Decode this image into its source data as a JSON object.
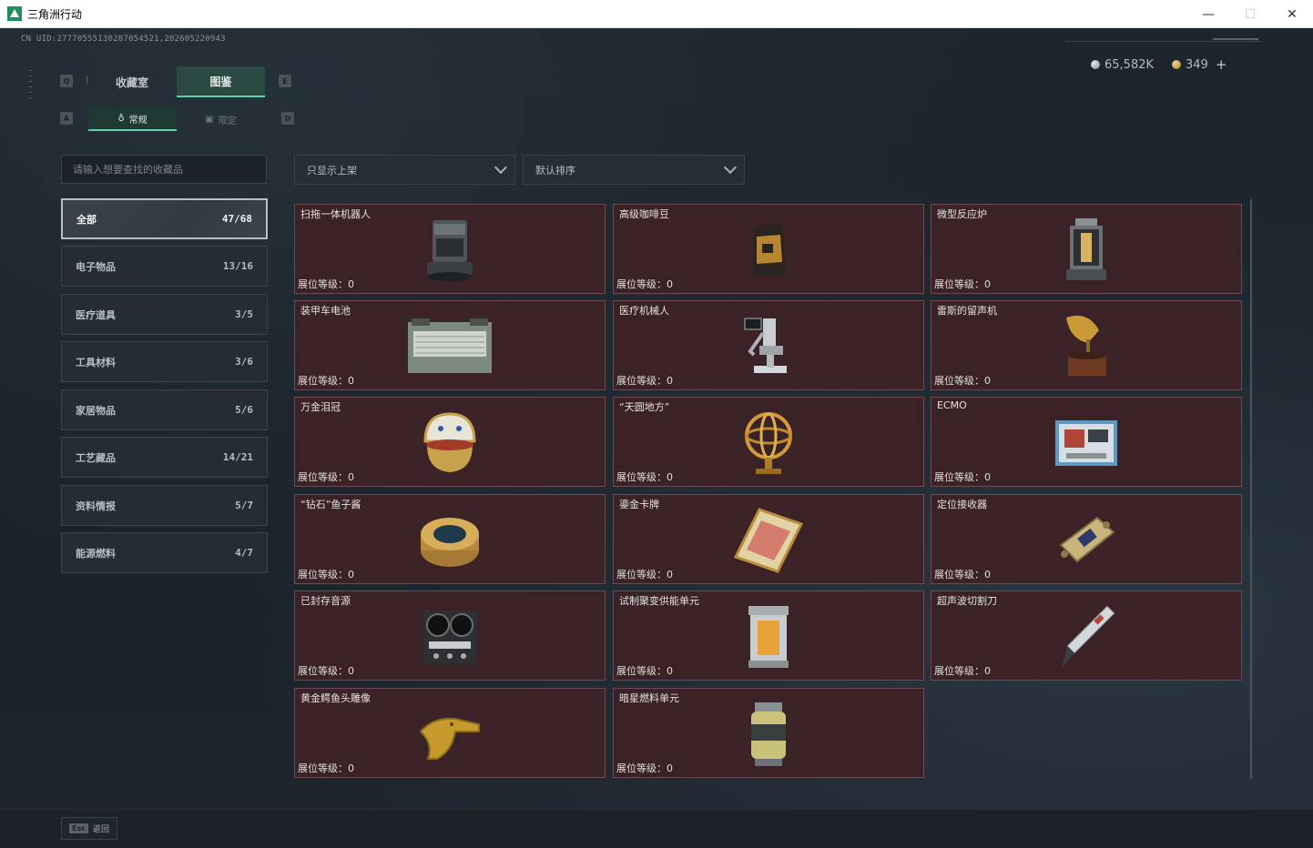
{
  "window": {
    "title": "三角洲行动",
    "minimize": "—",
    "maximize": "☐",
    "close": "✕"
  },
  "header": {
    "uid": "CN UID:27770555130287054521,202605220943",
    "currency": {
      "silver": "65,582K",
      "gold": "349",
      "plus": "+"
    }
  },
  "keys": {
    "prev_tab": "Q",
    "next_tab": "E",
    "prev_sub": "A",
    "next_sub": "D"
  },
  "tabs": [
    {
      "label": "收藏室"
    },
    {
      "label": "图鉴"
    }
  ],
  "subtabs": [
    {
      "label": "常规",
      "icon": "♁"
    },
    {
      "label": "限定",
      "icon": "▣"
    }
  ],
  "search": {
    "placeholder": "请输入想要查找的收藏品"
  },
  "filters": {
    "shelf": "只显示上架",
    "sort": "默认排序"
  },
  "categories": [
    {
      "label": "全部",
      "count": "47/68"
    },
    {
      "label": "电子物品",
      "count": "13/16"
    },
    {
      "label": "医疗道具",
      "count": "3/5"
    },
    {
      "label": "工具材料",
      "count": "3/6"
    },
    {
      "label": "家居物品",
      "count": "5/6"
    },
    {
      "label": "工艺藏品",
      "count": "14/21"
    },
    {
      "label": "资料情报",
      "count": "5/7"
    },
    {
      "label": "能源燃料",
      "count": "4/7"
    }
  ],
  "items": [
    {
      "name": "扫拖一体机器人",
      "level": "展位等级：0",
      "icon": "robot-vacuum-icon"
    },
    {
      "name": "高级咖啡豆",
      "level": "展位等级：0",
      "icon": "coffee-bag-icon"
    },
    {
      "name": "微型反应炉",
      "level": "展位等级：0",
      "icon": "reactor-icon"
    },
    {
      "name": "装甲车电池",
      "level": "展位等级：0",
      "icon": "battery-icon"
    },
    {
      "name": "医疗机械人",
      "level": "展位等级：0",
      "icon": "medical-robot-icon"
    },
    {
      "name": "雷斯的留声机",
      "level": "展位等级：0",
      "icon": "gramophone-icon"
    },
    {
      "name": "万金泪冠",
      "level": "展位等级：0",
      "icon": "jeweled-egg-icon"
    },
    {
      "name": "“天圆地方”",
      "level": "展位等级：0",
      "icon": "armillary-sphere-icon"
    },
    {
      "name": "ECMO",
      "level": "展位等级：0",
      "icon": "ecmo-machine-icon"
    },
    {
      "name": "“钻石”鱼子酱",
      "level": "展位等级：0",
      "icon": "caviar-tin-icon"
    },
    {
      "name": "鎏金卡牌",
      "level": "展位等级：0",
      "icon": "gold-card-icon"
    },
    {
      "name": "定位接收器",
      "level": "展位等级：0",
      "icon": "receiver-icon"
    },
    {
      "name": "已封存音源",
      "level": "展位等级：0",
      "icon": "tape-recorder-icon"
    },
    {
      "name": "试制聚变供能单元",
      "level": "展位等级：0",
      "icon": "fusion-cell-icon"
    },
    {
      "name": "超声波切割刀",
      "level": "展位等级：0",
      "icon": "ultrasonic-knife-icon"
    },
    {
      "name": "黄金鳄鱼头雕像",
      "level": "展位等级：0",
      "icon": "crocodile-statue-icon"
    },
    {
      "name": "暗星燃料单元",
      "level": "展位等级：0",
      "icon": "fuel-canister-icon"
    }
  ],
  "footer": {
    "esc_key": "Esc",
    "back": "返回"
  },
  "colors": {
    "accent": "#5fd1a6",
    "card_bg": "#3b2226",
    "card_border": "#6d4b50"
  }
}
